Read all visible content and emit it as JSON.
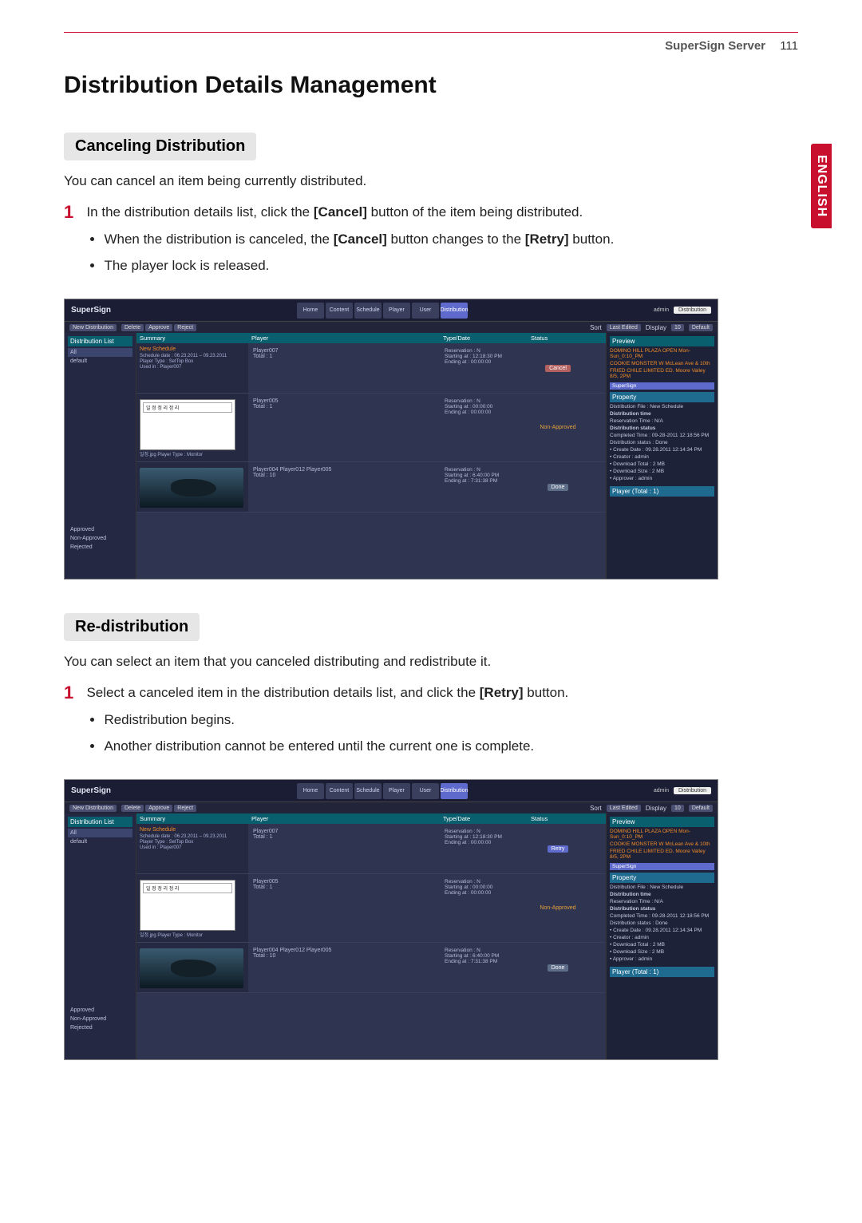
{
  "page": {
    "server_label": "SuperSign Server",
    "page_number": "111",
    "title": "Distribution Details Management",
    "side_tab": "ENGLISH"
  },
  "section1": {
    "heading": "Canceling Distribution",
    "lead": "You can cancel an item being currently distributed.",
    "step_num": "1",
    "step_text_pre": "In the distribution details list, click the ",
    "step_bold1": "[Cancel]",
    "step_text_post": " button of the item being distributed.",
    "bullet1_pre": "When the distribution is canceled, the ",
    "bullet1_b1": "[Cancel]",
    "bullet1_mid": " button changes to the ",
    "bullet1_b2": "[Retry]",
    "bullet1_post": " button.",
    "bullet2": "The player lock is released."
  },
  "section2": {
    "heading": "Re-distribution",
    "lead": "You can select an item that you canceled distributing and redistribute it.",
    "step_num": "1",
    "step_text_pre": "Select a canceled item in the distribution details list, and click the ",
    "step_bold1": "[Retry]",
    "step_text_post": " button.",
    "bullet1": "Redistribution begins.",
    "bullet2": "Another distribution cannot be entered until the current one is complete."
  },
  "app": {
    "logo": "SuperSign",
    "menu": {
      "home": "Home",
      "content": "Content",
      "schedule": "Schedule",
      "player": "Player",
      "user": "User",
      "distribution": "Distribution"
    },
    "top_right_user": "admin",
    "search_placeholder": "Distribution",
    "subbar": {
      "new": "New Distribution",
      "delete": "Delete",
      "approve": "Approve",
      "reject": "Reject",
      "sort": "Sort",
      "sort_value": "Last Edited",
      "display": "Display",
      "display_value": "10",
      "default": "Default"
    },
    "left_panel": {
      "title": "Distribution List",
      "all": "All",
      "default": "default",
      "approved": "Approved",
      "non_approved": "Non-Approved",
      "rejected": "Rejected"
    },
    "columns": {
      "summary": "Summary",
      "player": "Player",
      "type_date": "Type/Date",
      "status": "Status"
    },
    "rows": {
      "r1": {
        "title": "New Schedule",
        "date": "Schedule date : 06.23.2011 – 09.23.2011",
        "player_type": "Player Type : SetTop Box",
        "used_in": "Used in : Player007",
        "player_name": "Player007",
        "total": "Total : 1",
        "reservation": "Reservation : N",
        "starting": "Starting at :  12:18:30 PM",
        "ending": "Ending at :   00:00:00",
        "cancel": "Cancel",
        "retry": "Retry"
      },
      "r2": {
        "slide_title": "일 정 정 리 정 리",
        "player_name": "Player005",
        "total": "Total : 1",
        "reservation": "Reservation : N",
        "starting": "Starting at :  00:00:00",
        "ending": "Ending at :   00:00:00",
        "status": "Non-Approved",
        "footer": "일정.jpg   Player Type : Monitor"
      },
      "r3": {
        "players": "Player004  Player012  Player005",
        "total": "Total : 10",
        "reservation": "Reservation : N",
        "starting": "Starting at :   6:40:00 PM",
        "ending": "Ending at :   7:31:38 PM",
        "status": "Done"
      }
    },
    "right_panel": {
      "preview": "Preview",
      "promo1": "DOMINO HILL PLAZA OPEN  Mon-Sun_0:10_PM",
      "promo2": "COOKIE MONSTER W  McLean Ave & 10th",
      "promo3": "FRIED CHILE LIMITED ED.  Moore Valley 8/5, 2PM",
      "supersign": "SuperSign",
      "property": "Property",
      "dist_file": "Distribution File : New Schedule",
      "dist_time": "Distribution time",
      "resv_time": "Reservation Time : N/A",
      "dist_status": "Distribution status",
      "completed": "Completed Time : 09-28-2011 12:18:56 PM",
      "dist_status_val": "Distribution status : Done",
      "create_date": "• Create Date       : 09.28.2011 12:14:34 PM",
      "creator": "• Creator              : admin",
      "dl_total": "• Download Total : 2 MB",
      "dl_size": "• Download Size  : 2 MB",
      "approver": "• Approver           : admin",
      "player_total": "Player (Total : 1)"
    }
  }
}
